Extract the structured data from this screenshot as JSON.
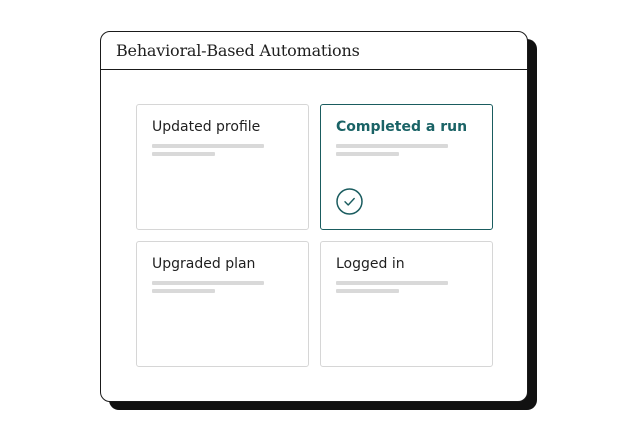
{
  "window": {
    "title": "Behavioral-Based Automations"
  },
  "cards": [
    {
      "label": "Updated profile",
      "selected": false
    },
    {
      "label": "Completed a run",
      "selected": true,
      "icon": "check-circle-icon"
    },
    {
      "label": "Upgraded plan",
      "selected": false
    },
    {
      "label": "Logged in",
      "selected": false
    }
  ],
  "colors": {
    "accent": "#1a6366",
    "border_selected": "#1a5c5f",
    "border_default": "#d6d6d6",
    "placeholder_line": "#d9d9d9",
    "window_border": "#1a1a1a",
    "shadow": "#111111"
  }
}
